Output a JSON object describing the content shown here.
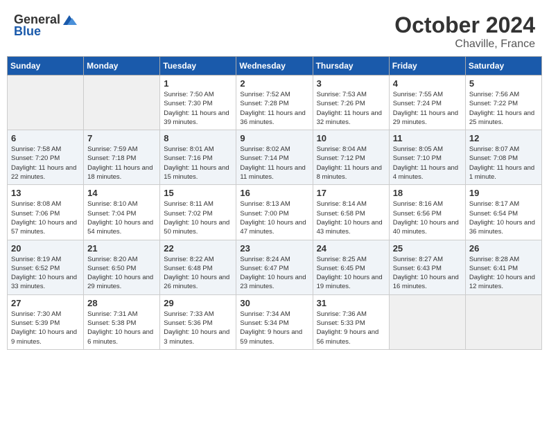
{
  "header": {
    "logo_general": "General",
    "logo_blue": "Blue",
    "month": "October 2024",
    "location": "Chaville, France"
  },
  "days_of_week": [
    "Sunday",
    "Monday",
    "Tuesday",
    "Wednesday",
    "Thursday",
    "Friday",
    "Saturday"
  ],
  "weeks": [
    [
      {
        "day": "",
        "sunrise": "",
        "sunset": "",
        "daylight": ""
      },
      {
        "day": "",
        "sunrise": "",
        "sunset": "",
        "daylight": ""
      },
      {
        "day": "1",
        "sunrise": "Sunrise: 7:50 AM",
        "sunset": "Sunset: 7:30 PM",
        "daylight": "Daylight: 11 hours and 39 minutes."
      },
      {
        "day": "2",
        "sunrise": "Sunrise: 7:52 AM",
        "sunset": "Sunset: 7:28 PM",
        "daylight": "Daylight: 11 hours and 36 minutes."
      },
      {
        "day": "3",
        "sunrise": "Sunrise: 7:53 AM",
        "sunset": "Sunset: 7:26 PM",
        "daylight": "Daylight: 11 hours and 32 minutes."
      },
      {
        "day": "4",
        "sunrise": "Sunrise: 7:55 AM",
        "sunset": "Sunset: 7:24 PM",
        "daylight": "Daylight: 11 hours and 29 minutes."
      },
      {
        "day": "5",
        "sunrise": "Sunrise: 7:56 AM",
        "sunset": "Sunset: 7:22 PM",
        "daylight": "Daylight: 11 hours and 25 minutes."
      }
    ],
    [
      {
        "day": "6",
        "sunrise": "Sunrise: 7:58 AM",
        "sunset": "Sunset: 7:20 PM",
        "daylight": "Daylight: 11 hours and 22 minutes."
      },
      {
        "day": "7",
        "sunrise": "Sunrise: 7:59 AM",
        "sunset": "Sunset: 7:18 PM",
        "daylight": "Daylight: 11 hours and 18 minutes."
      },
      {
        "day": "8",
        "sunrise": "Sunrise: 8:01 AM",
        "sunset": "Sunset: 7:16 PM",
        "daylight": "Daylight: 11 hours and 15 minutes."
      },
      {
        "day": "9",
        "sunrise": "Sunrise: 8:02 AM",
        "sunset": "Sunset: 7:14 PM",
        "daylight": "Daylight: 11 hours and 11 minutes."
      },
      {
        "day": "10",
        "sunrise": "Sunrise: 8:04 AM",
        "sunset": "Sunset: 7:12 PM",
        "daylight": "Daylight: 11 hours and 8 minutes."
      },
      {
        "day": "11",
        "sunrise": "Sunrise: 8:05 AM",
        "sunset": "Sunset: 7:10 PM",
        "daylight": "Daylight: 11 hours and 4 minutes."
      },
      {
        "day": "12",
        "sunrise": "Sunrise: 8:07 AM",
        "sunset": "Sunset: 7:08 PM",
        "daylight": "Daylight: 11 hours and 1 minute."
      }
    ],
    [
      {
        "day": "13",
        "sunrise": "Sunrise: 8:08 AM",
        "sunset": "Sunset: 7:06 PM",
        "daylight": "Daylight: 10 hours and 57 minutes."
      },
      {
        "day": "14",
        "sunrise": "Sunrise: 8:10 AM",
        "sunset": "Sunset: 7:04 PM",
        "daylight": "Daylight: 10 hours and 54 minutes."
      },
      {
        "day": "15",
        "sunrise": "Sunrise: 8:11 AM",
        "sunset": "Sunset: 7:02 PM",
        "daylight": "Daylight: 10 hours and 50 minutes."
      },
      {
        "day": "16",
        "sunrise": "Sunrise: 8:13 AM",
        "sunset": "Sunset: 7:00 PM",
        "daylight": "Daylight: 10 hours and 47 minutes."
      },
      {
        "day": "17",
        "sunrise": "Sunrise: 8:14 AM",
        "sunset": "Sunset: 6:58 PM",
        "daylight": "Daylight: 10 hours and 43 minutes."
      },
      {
        "day": "18",
        "sunrise": "Sunrise: 8:16 AM",
        "sunset": "Sunset: 6:56 PM",
        "daylight": "Daylight: 10 hours and 40 minutes."
      },
      {
        "day": "19",
        "sunrise": "Sunrise: 8:17 AM",
        "sunset": "Sunset: 6:54 PM",
        "daylight": "Daylight: 10 hours and 36 minutes."
      }
    ],
    [
      {
        "day": "20",
        "sunrise": "Sunrise: 8:19 AM",
        "sunset": "Sunset: 6:52 PM",
        "daylight": "Daylight: 10 hours and 33 minutes."
      },
      {
        "day": "21",
        "sunrise": "Sunrise: 8:20 AM",
        "sunset": "Sunset: 6:50 PM",
        "daylight": "Daylight: 10 hours and 29 minutes."
      },
      {
        "day": "22",
        "sunrise": "Sunrise: 8:22 AM",
        "sunset": "Sunset: 6:48 PM",
        "daylight": "Daylight: 10 hours and 26 minutes."
      },
      {
        "day": "23",
        "sunrise": "Sunrise: 8:24 AM",
        "sunset": "Sunset: 6:47 PM",
        "daylight": "Daylight: 10 hours and 23 minutes."
      },
      {
        "day": "24",
        "sunrise": "Sunrise: 8:25 AM",
        "sunset": "Sunset: 6:45 PM",
        "daylight": "Daylight: 10 hours and 19 minutes."
      },
      {
        "day": "25",
        "sunrise": "Sunrise: 8:27 AM",
        "sunset": "Sunset: 6:43 PM",
        "daylight": "Daylight: 10 hours and 16 minutes."
      },
      {
        "day": "26",
        "sunrise": "Sunrise: 8:28 AM",
        "sunset": "Sunset: 6:41 PM",
        "daylight": "Daylight: 10 hours and 12 minutes."
      }
    ],
    [
      {
        "day": "27",
        "sunrise": "Sunrise: 7:30 AM",
        "sunset": "Sunset: 5:39 PM",
        "daylight": "Daylight: 10 hours and 9 minutes."
      },
      {
        "day": "28",
        "sunrise": "Sunrise: 7:31 AM",
        "sunset": "Sunset: 5:38 PM",
        "daylight": "Daylight: 10 hours and 6 minutes."
      },
      {
        "day": "29",
        "sunrise": "Sunrise: 7:33 AM",
        "sunset": "Sunset: 5:36 PM",
        "daylight": "Daylight: 10 hours and 3 minutes."
      },
      {
        "day": "30",
        "sunrise": "Sunrise: 7:34 AM",
        "sunset": "Sunset: 5:34 PM",
        "daylight": "Daylight: 9 hours and 59 minutes."
      },
      {
        "day": "31",
        "sunrise": "Sunrise: 7:36 AM",
        "sunset": "Sunset: 5:33 PM",
        "daylight": "Daylight: 9 hours and 56 minutes."
      },
      {
        "day": "",
        "sunrise": "",
        "sunset": "",
        "daylight": ""
      },
      {
        "day": "",
        "sunrise": "",
        "sunset": "",
        "daylight": ""
      }
    ]
  ]
}
